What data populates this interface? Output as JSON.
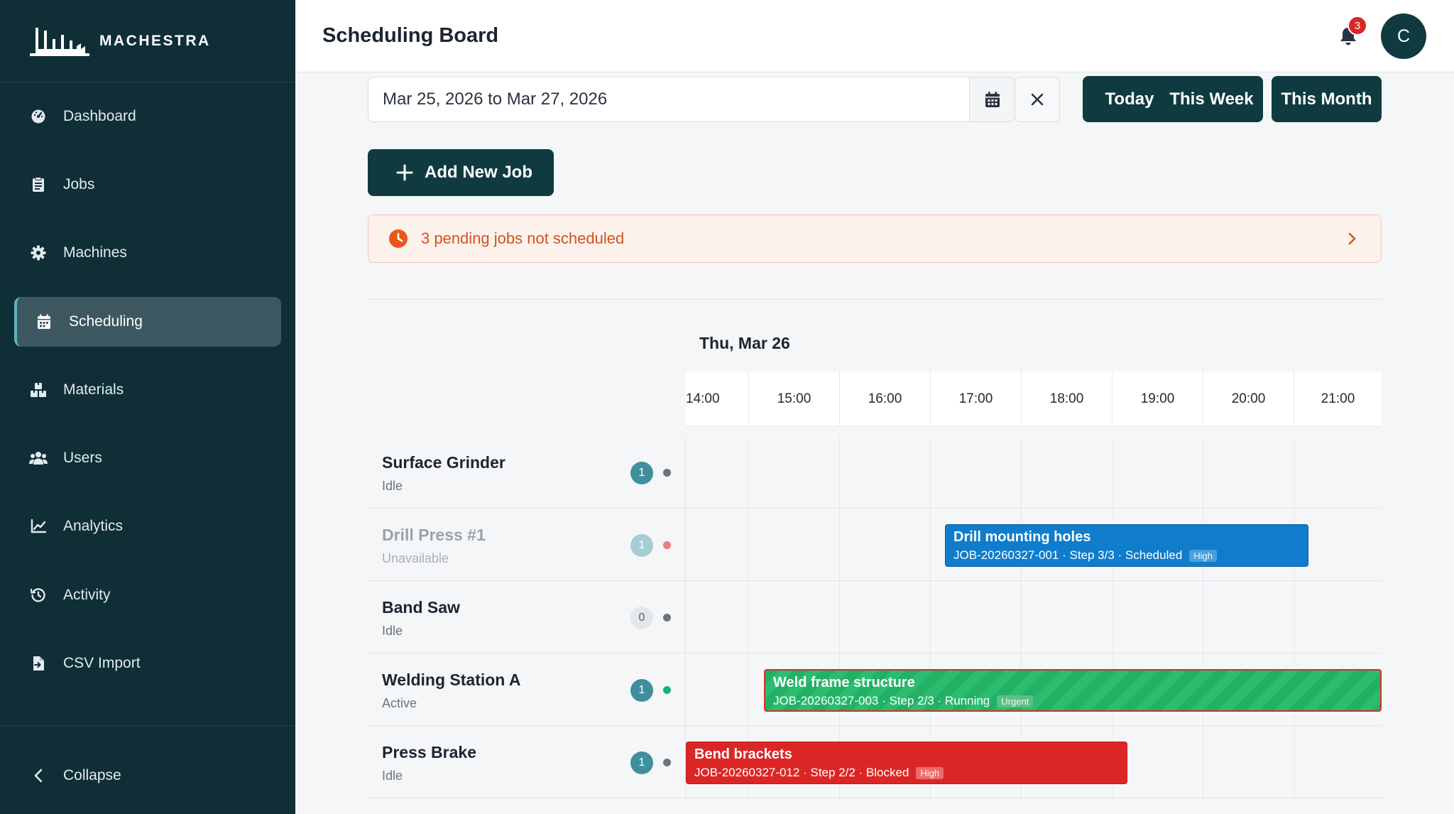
{
  "brand": {
    "name": "MACHESTRA"
  },
  "nav": [
    {
      "label": "Dashboard",
      "icon": "dashboard-icon"
    },
    {
      "label": "Jobs",
      "icon": "clipboard-icon"
    },
    {
      "label": "Machines",
      "icon": "gear-icon"
    },
    {
      "label": "Scheduling",
      "icon": "calendar-icon",
      "active": true
    },
    {
      "label": "Materials",
      "icon": "boxes-icon"
    },
    {
      "label": "Users",
      "icon": "users-icon"
    },
    {
      "label": "Analytics",
      "icon": "chart-line-icon"
    },
    {
      "label": "Activity",
      "icon": "history-icon"
    },
    {
      "label": "CSV Import",
      "icon": "file-import-icon"
    }
  ],
  "collapse_label": "Collapse",
  "header": {
    "title": "Scheduling Board",
    "notifications": "3",
    "avatar": "C"
  },
  "toolbar": {
    "date_range": "Mar 25, 2026 to Mar 27, 2026",
    "today": "Today",
    "this_week": "This Week",
    "this_month": "This Month",
    "add_job": "Add New Job"
  },
  "alert": {
    "text": "3 pending jobs not scheduled"
  },
  "gantt": {
    "day": "Thu, Mar 26",
    "times": [
      "14:00",
      "15:00",
      "16:00",
      "17:00",
      "18:00",
      "19:00",
      "20:00",
      "21:00"
    ],
    "machines": [
      {
        "name": "Surface Grinder",
        "status": "Idle",
        "count": "1"
      },
      {
        "name": "Drill Press #1",
        "status": "Unavailable",
        "count": "1"
      },
      {
        "name": "Band Saw",
        "status": "Idle",
        "count": "0"
      },
      {
        "name": "Welding Station A",
        "status": "Active",
        "count": "1"
      },
      {
        "name": "Press Brake",
        "status": "Idle",
        "count": "1"
      }
    ],
    "jobs": [
      {
        "title": "Drill mounting holes",
        "meta": "JOB-20260327-001 · Step 3/3 · Scheduled",
        "priority": "High"
      },
      {
        "title": "Weld frame structure",
        "meta": "JOB-20260327-003 · Step 2/3 · Running",
        "priority": "Urgent"
      },
      {
        "title": "Bend brackets",
        "meta": "JOB-20260327-012 · Step 2/2 · Blocked",
        "priority": "High"
      }
    ]
  },
  "colors": {
    "sidebar": "#0f2e36",
    "primary": "#0f3b40",
    "scheduled": "#0f7dcc",
    "running": "#22b064",
    "blocked": "#dc2626",
    "alert_text": "#d2531e",
    "status_idle": "#6b7280",
    "status_unavailable": "#e88080",
    "status_active": "#16b272"
  }
}
